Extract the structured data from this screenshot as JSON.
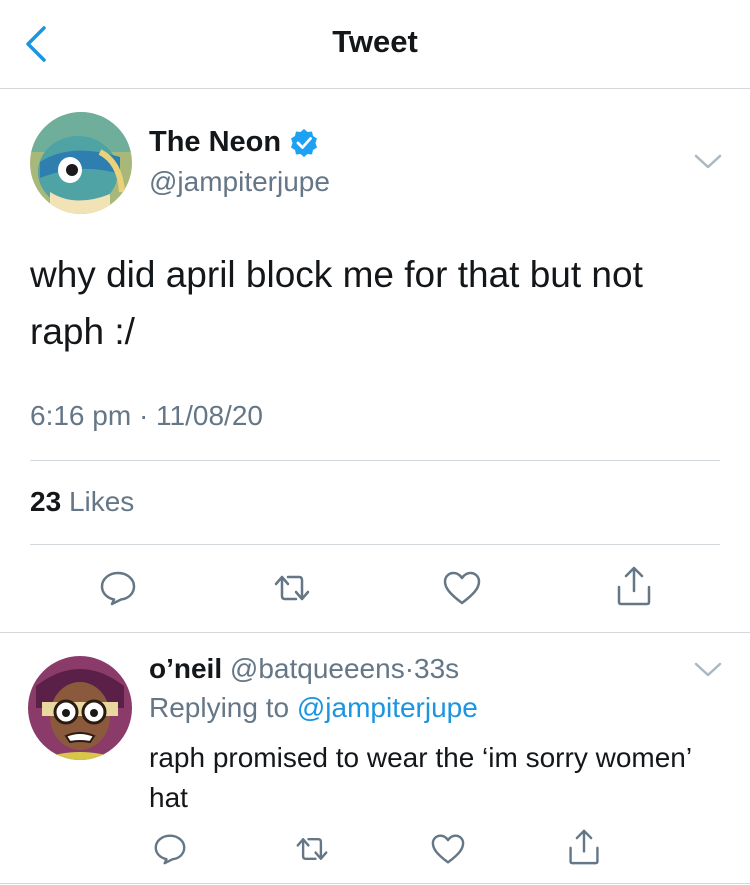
{
  "header": {
    "title": "Tweet",
    "back_icon": "chevron-left-icon"
  },
  "tweet": {
    "author_name": "The Neon",
    "verified": true,
    "handle": "@jampiterjupe",
    "text": "why did april block me for that but not raph :/",
    "time": "6:16 pm · 11/08/20",
    "likes_count": "23",
    "likes_label": "Likes"
  },
  "reply": {
    "author_name": "o’neil",
    "handle": "@batqueeens",
    "separator": "·",
    "age": "33s",
    "replying_prefix": "Replying to",
    "replying_to": "@jampiterjupe",
    "text": "raph promised to wear the ‘im sorry women’ hat"
  },
  "colors": {
    "accent": "#1b95e0",
    "secondary_text": "#657786",
    "divider": "#d3d8dc",
    "icon": "#657786"
  },
  "icons": [
    "comment-icon",
    "retweet-icon",
    "like-icon",
    "share-icon",
    "verified-badge-icon",
    "chevron-down-icon"
  ]
}
